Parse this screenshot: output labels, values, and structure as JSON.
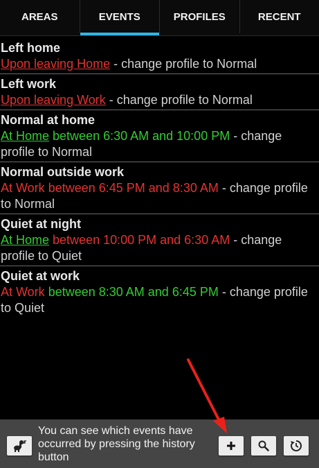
{
  "tabs": [
    {
      "label": "AREAS",
      "active": false
    },
    {
      "label": "EVENTS",
      "active": true
    },
    {
      "label": "PROFILES",
      "active": false
    },
    {
      "label": "RECENT",
      "active": false
    }
  ],
  "events": [
    {
      "title": "Left home",
      "desc": {
        "part1": "Upon leaving Home",
        "part2": " - change profile to Normal"
      }
    },
    {
      "title": "Left work",
      "desc": {
        "part1": "Upon leaving Work",
        "part2": " - change profile to Normal"
      }
    },
    {
      "title": "Normal at home",
      "desc": {
        "place": "At Home",
        "time": " between 6:30 AM and 10:00 PM",
        "rest": " - change profile to Normal"
      }
    },
    {
      "title": "Normal outside work",
      "desc": {
        "place": "At Work",
        "time": " between 6:45 PM and 8:30 AM",
        "rest": " - change profile to Normal"
      }
    },
    {
      "title": "Quiet at night",
      "desc": {
        "place": "At Home",
        "time": " between 10:00 PM and 6:30 AM",
        "rest": " - change profile to Quiet"
      }
    },
    {
      "title": "Quiet at work",
      "desc": {
        "place": "At Work",
        "time": " between 8:30 AM and 6:45 PM",
        "rest": " - change profile to Quiet"
      }
    }
  ],
  "bottom": {
    "hint": "You can see which events have occurred by pressing the history button",
    "buttons": {
      "left_icon": "hint-mascot-icon",
      "add_icon": "plus-icon",
      "search_icon": "search-icon",
      "history_icon": "history-icon"
    }
  },
  "colors": {
    "tab_indicator": "#33b5e5",
    "red": "#e53232",
    "green": "#33cc33",
    "annotation_arrow": "#e8221b"
  }
}
